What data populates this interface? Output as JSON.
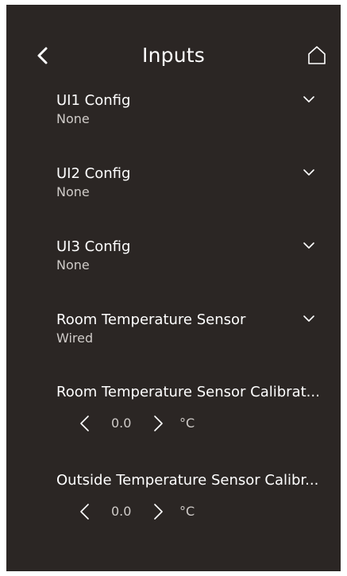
{
  "header": {
    "title": "Inputs",
    "back_icon": "chevron-left-icon",
    "home_icon": "home-icon"
  },
  "config_rows": [
    {
      "title": "UI1 Config",
      "value": "None"
    },
    {
      "title": "UI2 Config",
      "value": "None"
    },
    {
      "title": "UI3 Config",
      "value": "None"
    },
    {
      "title": "Room Temperature Sensor",
      "value": "Wired"
    }
  ],
  "calibration_rows": [
    {
      "title": "Room Temperature Sensor Calibrat...",
      "value": "0.0",
      "unit": "°C"
    },
    {
      "title": "Outside Temperature Sensor Calibr...",
      "value": "0.0",
      "unit": "°C"
    }
  ],
  "colors": {
    "background": "#2b2624",
    "text": "#ffffff",
    "secondary_text": "#cfcbc8"
  }
}
